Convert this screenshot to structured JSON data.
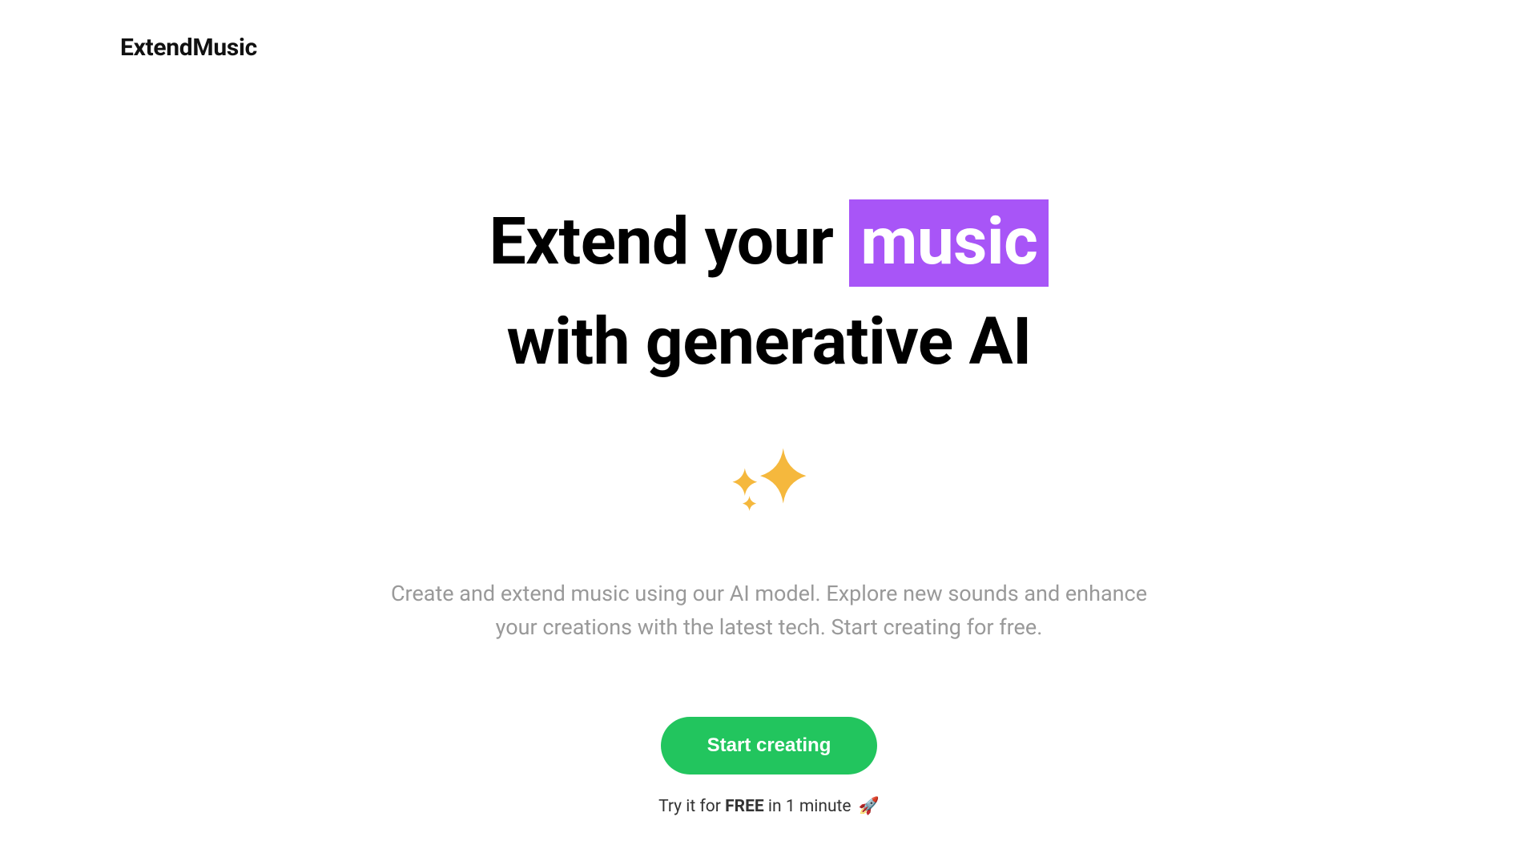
{
  "header": {
    "brand": "ExtendMusic"
  },
  "hero": {
    "headline_pre": "Extend your ",
    "headline_highlight": "music",
    "headline_post": "with generative AI",
    "sparkle_icon": "sparkles-icon",
    "description": "Create and extend music using our AI model. Explore new sounds and enhance your creations with the latest tech. Start creating for free.",
    "cta_label": "Start creating",
    "tagline_pre": "Try it for ",
    "tagline_bold": "FREE",
    "tagline_post": " in 1 minute ",
    "tagline_emoji": "🚀"
  },
  "colors": {
    "highlight_bg": "#a855f7",
    "cta_bg": "#22c55e",
    "sparkle_fill": "#f5b83d"
  }
}
